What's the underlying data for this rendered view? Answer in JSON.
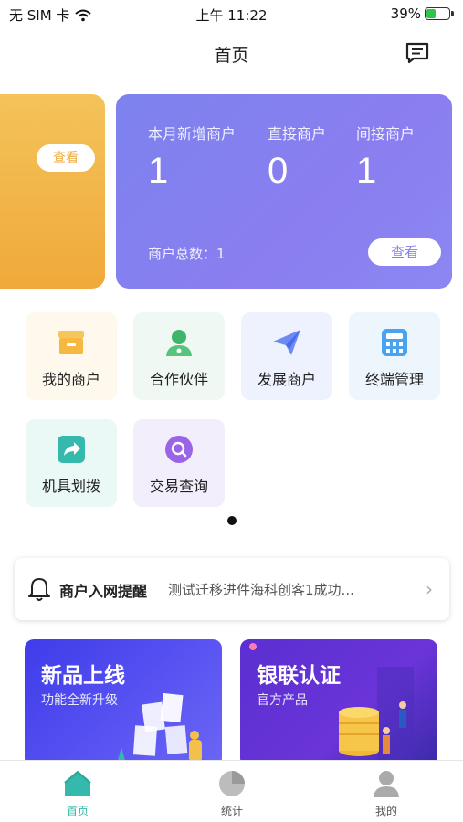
{
  "status_bar": {
    "carrier": "无 SIM 卡",
    "time": "上午 11:22",
    "battery": "39%"
  },
  "nav": {
    "title": "首页"
  },
  "cards": {
    "left": {
      "view_label": "查看"
    },
    "main": {
      "stats": [
        {
          "label": "本月新增商户",
          "value": "1"
        },
        {
          "label": "直接商户",
          "value": "0"
        },
        {
          "label": "间接商户",
          "value": "1"
        }
      ],
      "total_text": "商户总数：1",
      "view_label": "查看"
    }
  },
  "grid": {
    "items": [
      {
        "label": "我的商户",
        "icon": "store-icon",
        "color": "#f5b942"
      },
      {
        "label": "合作伙伴",
        "icon": "partner-icon",
        "color": "#3fb46a"
      },
      {
        "label": "发展商户",
        "icon": "paper-plane-icon",
        "color": "#5c7ef0"
      },
      {
        "label": "终端管理",
        "icon": "calculator-icon",
        "color": "#4aa3f0"
      },
      {
        "label": "机具划拨",
        "icon": "share-arrow-icon",
        "color": "#35b9ac"
      },
      {
        "label": "交易查询",
        "icon": "search-circle-icon",
        "color": "#9a64e8"
      }
    ]
  },
  "notice": {
    "title": "商户入网提醒",
    "text": "测试迁移进件海科创客1成功..."
  },
  "banners": [
    {
      "title": "新品上线",
      "subtitle": "功能全新升级"
    },
    {
      "title": "银联认证",
      "subtitle": "官方产品"
    }
  ],
  "tabs": [
    {
      "label": "首页",
      "icon": "home-icon",
      "active": true
    },
    {
      "label": "统计",
      "icon": "pie-chart-icon",
      "active": false
    },
    {
      "label": "我的",
      "icon": "user-icon",
      "active": false
    }
  ],
  "colors": {
    "accent": "#35b9ac",
    "card_purple": "#8a7ef0",
    "card_orange": "#f0a93a"
  }
}
